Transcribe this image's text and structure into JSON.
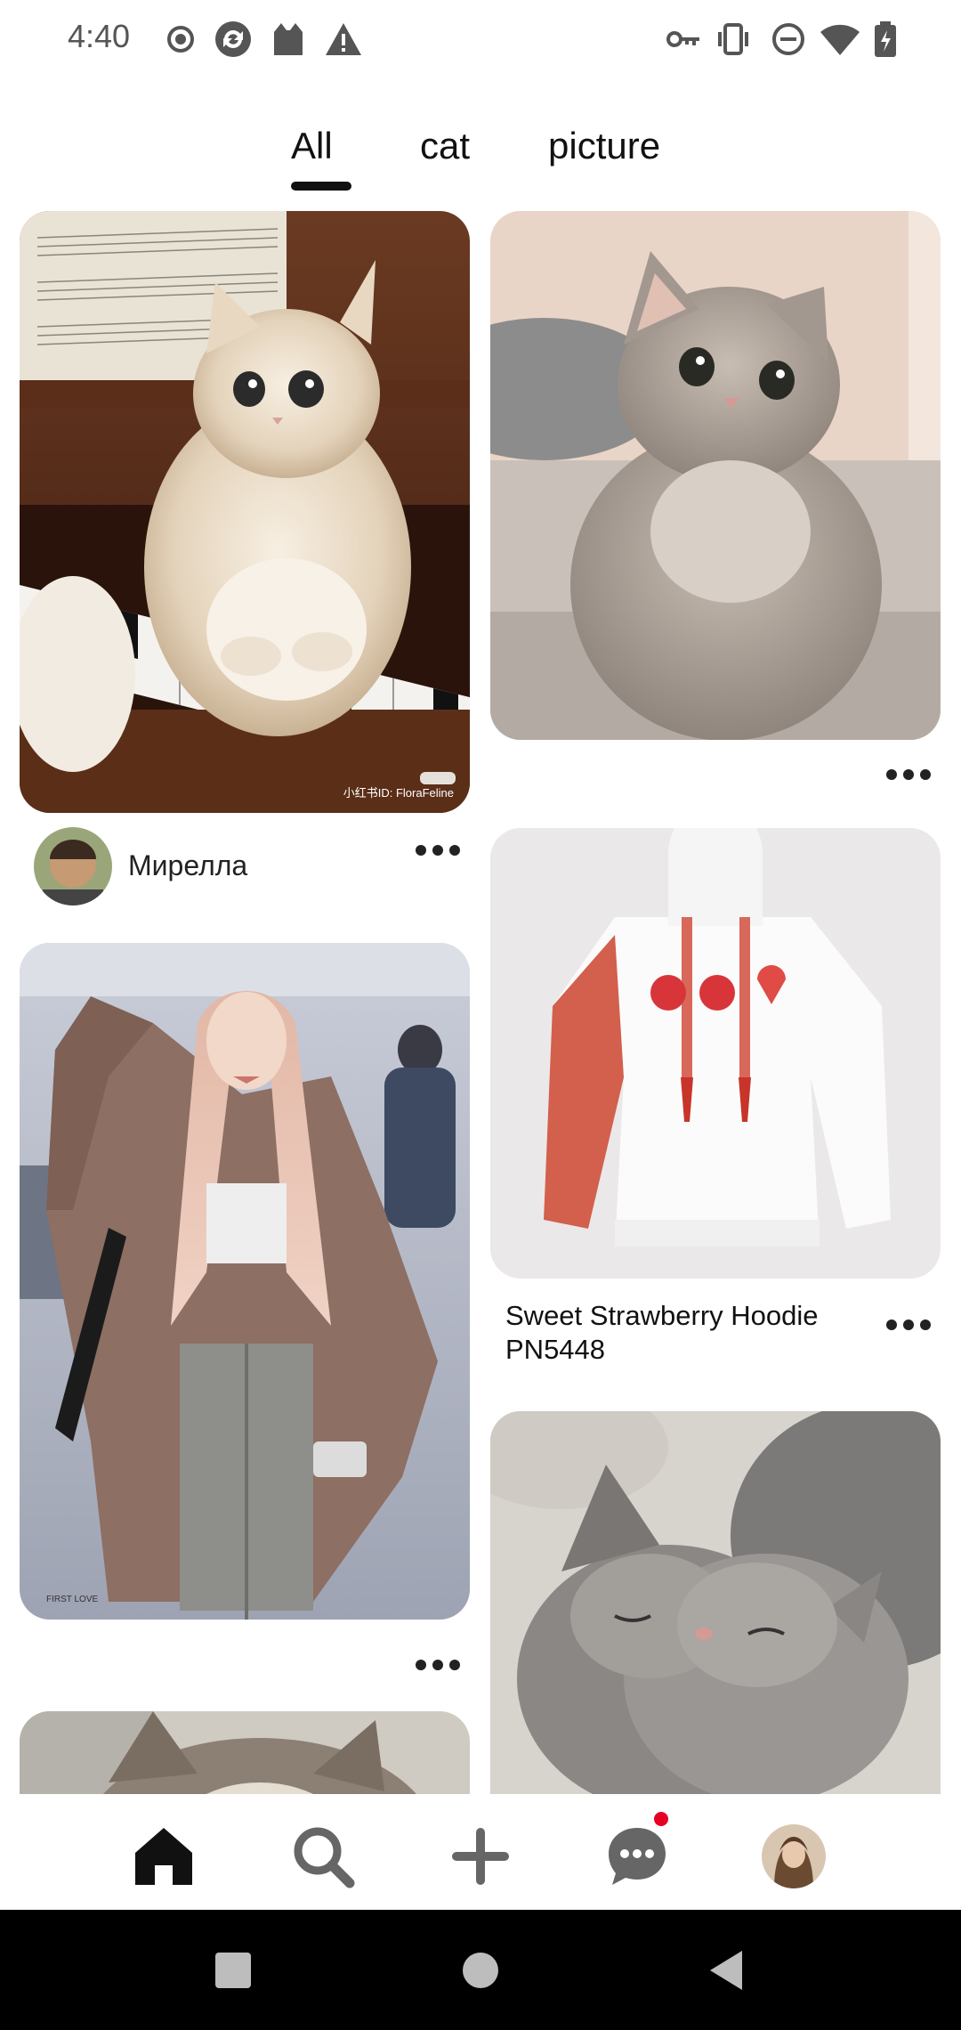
{
  "status_bar": {
    "time": "4:40",
    "left_icons": [
      "record-icon",
      "sync-icon",
      "cat-app-icon",
      "warning-icon"
    ],
    "right_icons": [
      "key-icon",
      "vibrate-icon",
      "dnd-icon",
      "wifi-icon",
      "battery-icon"
    ]
  },
  "tabs": [
    {
      "label": "All",
      "selected": true
    },
    {
      "label": "cat",
      "selected": false
    },
    {
      "label": "picture",
      "selected": false
    }
  ],
  "feed": {
    "left_column": [
      {
        "image": "white fluffy cat sitting on piano keys",
        "watermark": "小红书ID: FloraFeline",
        "user": "Мирелла"
      },
      {
        "image": "woman with long pink hair in camel coat"
      },
      {
        "image": "fluffy cat (partially visible)"
      }
    ],
    "right_column": [
      {
        "image": "grey british shorthair cat on sofa"
      },
      {
        "image": "white hoodie with red sleeve and strawberry print",
        "title": "Sweet Strawberry Hoodie PN5448"
      },
      {
        "image": "two grey kittens sleeping"
      }
    ]
  },
  "bottom_nav": {
    "items": [
      "home-icon",
      "search-icon",
      "create-icon",
      "messages-icon",
      "profile-avatar"
    ],
    "active": "home-icon",
    "accent": "#e60023"
  }
}
